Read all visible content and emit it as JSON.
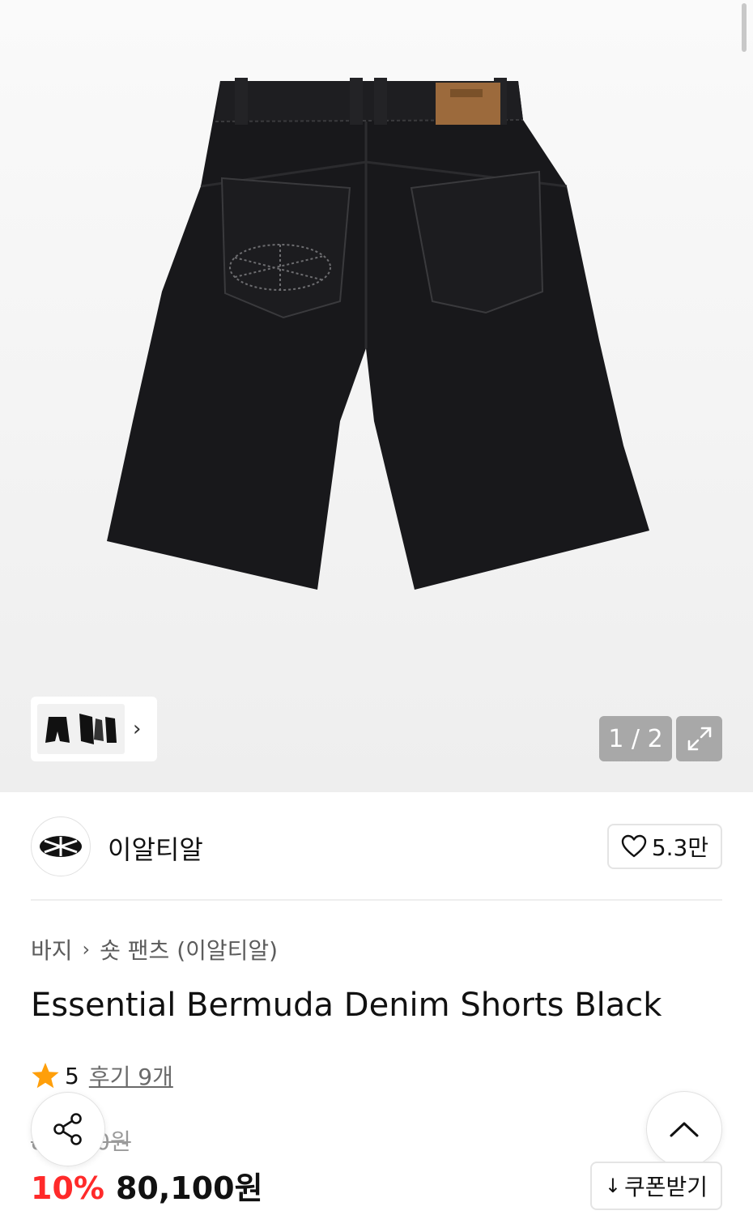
{
  "gallery": {
    "counter": "1 / 2",
    "thumb_arrow": "›",
    "icons": {
      "fullscreen": "expand-icon",
      "next": "chevron-right-icon"
    }
  },
  "brand": {
    "name": "이알티알",
    "likes": "5.3만",
    "icons": {
      "like": "heart-icon"
    }
  },
  "breadcrumb": {
    "category": "바지",
    "separator": "›",
    "subcategory": "숏 팬츠 (이알티알)"
  },
  "product": {
    "title": "Essential Bermuda Denim Shorts Black",
    "rating": "5",
    "review_label": "후기 9개",
    "original_price": "89,000원",
    "discount": "10%",
    "sale_price": "80,100원"
  },
  "actions": {
    "coupon_label": "쿠폰받기",
    "coupon_icon": "↓",
    "icons": {
      "share": "share-icon",
      "top": "chevron-up-icon"
    }
  },
  "colors": {
    "discount": "#ff2a2a",
    "star": "#ff9f0a",
    "border": "#e4e4e4"
  }
}
